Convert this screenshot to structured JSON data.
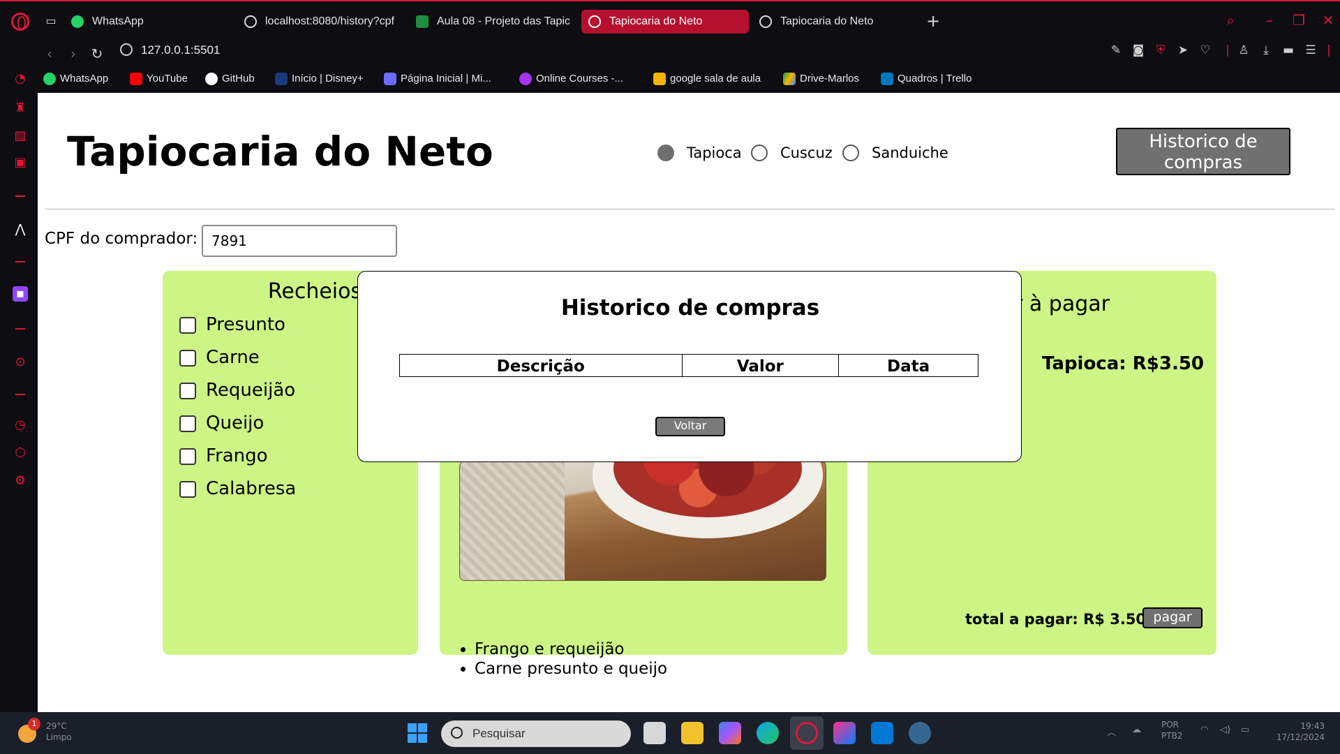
{
  "browser": {
    "tabs": [
      {
        "label": "WhatsApp",
        "active": false
      },
      {
        "label": "localhost:8080/history?cpf",
        "active": false
      },
      {
        "label": "Aula 08 - Projeto das Tapic",
        "active": false
      },
      {
        "label": "Tapiocaria do Neto",
        "active": true
      },
      {
        "label": "Tapiocaria do Neto",
        "active": false
      }
    ],
    "url": "127.0.0.1:5501",
    "bookmarks": [
      "WhatsApp",
      "YouTube",
      "GitHub",
      "Início | Disney+",
      "Página Inicial | Mi...",
      "Online Courses -...",
      "google sala de aula",
      "Drive-Marlos",
      "Quadros | Trello"
    ],
    "sidebar_label": "GX",
    "accent": "#e0163a"
  },
  "page": {
    "title": "Tapiocaria do Neto",
    "radio_options": [
      {
        "label": "Tapioca",
        "checked": true
      },
      {
        "label": "Cuscuz",
        "checked": false
      },
      {
        "label": "Sanduiche",
        "checked": false
      }
    ],
    "history_button": "Historico de compras",
    "cpf_label": "CPF do comprador:",
    "cpf_value": "7891",
    "recheios": {
      "title": "Recheios",
      "items": [
        "Presunto",
        "Carne",
        "Requeijão",
        "Queijo",
        "Frango",
        "Calabresa"
      ]
    },
    "suggestions": [
      "Frango e requeijão",
      "Carne presunto e queijo"
    ],
    "payment": {
      "title_visible": "r à pagar",
      "price_line": "Tapioca: R$3.50",
      "total_line": "total a pagar: R$ 3.50",
      "pay_button": "pagar"
    },
    "panel_color": "#ccf585"
  },
  "modal": {
    "title": "Historico de compras",
    "columns": [
      "Descrição",
      "Valor",
      "Data"
    ],
    "back_button": "Voltar"
  },
  "taskbar": {
    "weather_badge": "1",
    "temperature": "29°C",
    "weather_desc": "Limpo",
    "search_placeholder": "Pesquisar",
    "lang_top": "POR",
    "lang_bottom": "PTB2",
    "time": "19:43",
    "date": "17/12/2024"
  }
}
